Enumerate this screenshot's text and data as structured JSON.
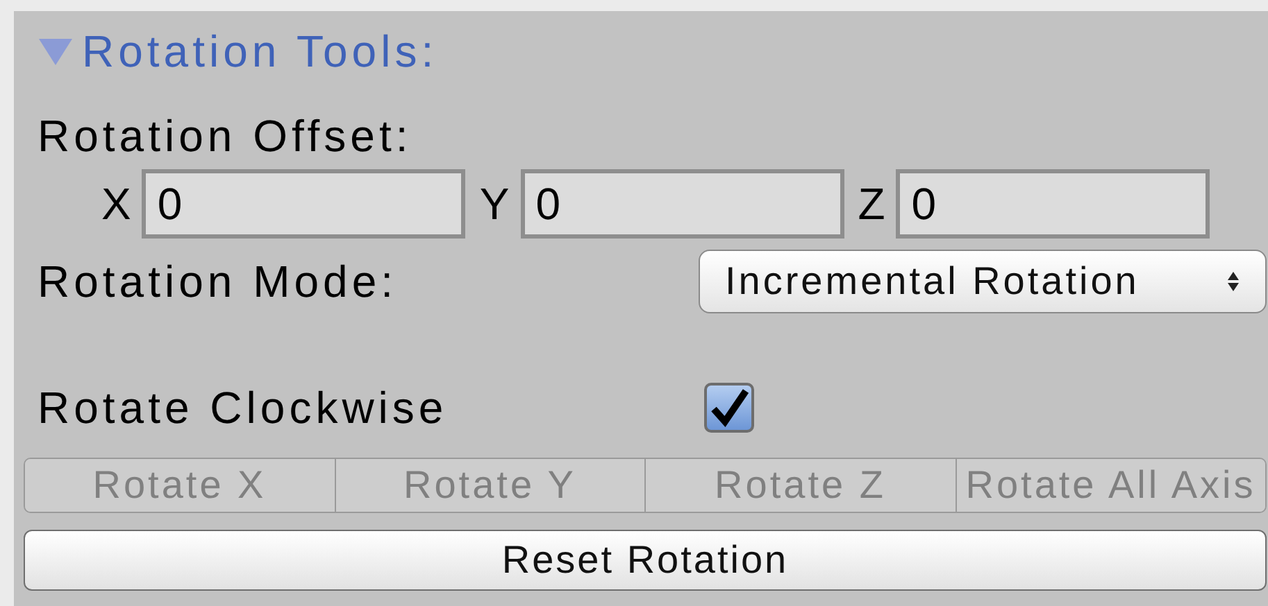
{
  "section": {
    "title": "Rotation Tools:",
    "expanded": true
  },
  "offset": {
    "label": "Rotation Offset:",
    "fields": [
      {
        "axis": "X",
        "value": "0"
      },
      {
        "axis": "Y",
        "value": "0"
      },
      {
        "axis": "Z",
        "value": "0"
      }
    ]
  },
  "mode": {
    "label": "Rotation Mode:",
    "value": "Incremental Rotation"
  },
  "clockwise": {
    "label": "Rotate Clockwise",
    "checked": true
  },
  "rotate_buttons": [
    {
      "label": "Rotate X",
      "disabled": true
    },
    {
      "label": "Rotate Y",
      "disabled": true
    },
    {
      "label": "Rotate Z",
      "disabled": true
    },
    {
      "label": "Rotate All Axis",
      "disabled": true
    }
  ],
  "reset_button": {
    "label": "Reset Rotation"
  }
}
